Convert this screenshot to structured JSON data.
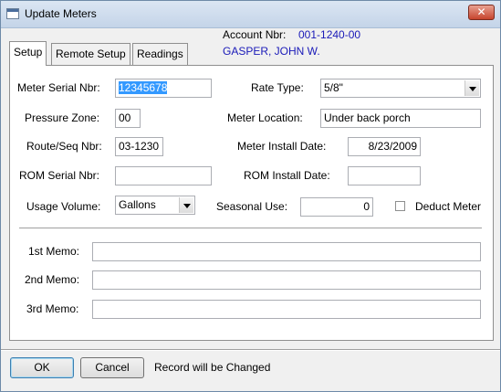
{
  "window": {
    "title": "Update Meters",
    "close_glyph": "✕"
  },
  "account": {
    "label": "Account Nbr:",
    "number": "001-1240-00",
    "customer_name": "GASPER, JOHN W."
  },
  "tabs": [
    {
      "label": "Setup",
      "active": true
    },
    {
      "label": "Remote Setup",
      "active": false
    },
    {
      "label": "Readings",
      "active": false
    }
  ],
  "form": {
    "meter_serial": {
      "label": "Meter Serial Nbr:",
      "value": "12345678"
    },
    "rate_type": {
      "label": "Rate Type:",
      "value": "5/8\""
    },
    "pressure_zone": {
      "label": "Pressure Zone:",
      "value": "00"
    },
    "meter_location": {
      "label": "Meter Location:",
      "value": "Under back porch"
    },
    "route_seq": {
      "label": "Route/Seq Nbr:",
      "value": "03-1230"
    },
    "install_date": {
      "label": "Meter Install Date:",
      "value": "8/23/2009"
    },
    "rom_serial": {
      "label": "ROM Serial Nbr:",
      "value": ""
    },
    "rom_install_date": {
      "label": "ROM Install Date:",
      "value": ""
    },
    "usage_volume": {
      "label": "Usage Volume:",
      "value": "Gallons"
    },
    "seasonal_use": {
      "label": "Seasonal Use:",
      "value": "0"
    },
    "deduct_meter": {
      "label": "Deduct Meter",
      "checked": false
    },
    "memo1": {
      "label": "1st Memo:",
      "value": ""
    },
    "memo2": {
      "label": "2nd Memo:",
      "value": ""
    },
    "memo3": {
      "label": "3rd Memo:",
      "value": ""
    }
  },
  "footer": {
    "ok_label": "OK",
    "cancel_label": "Cancel",
    "status": "Record will be Changed"
  }
}
